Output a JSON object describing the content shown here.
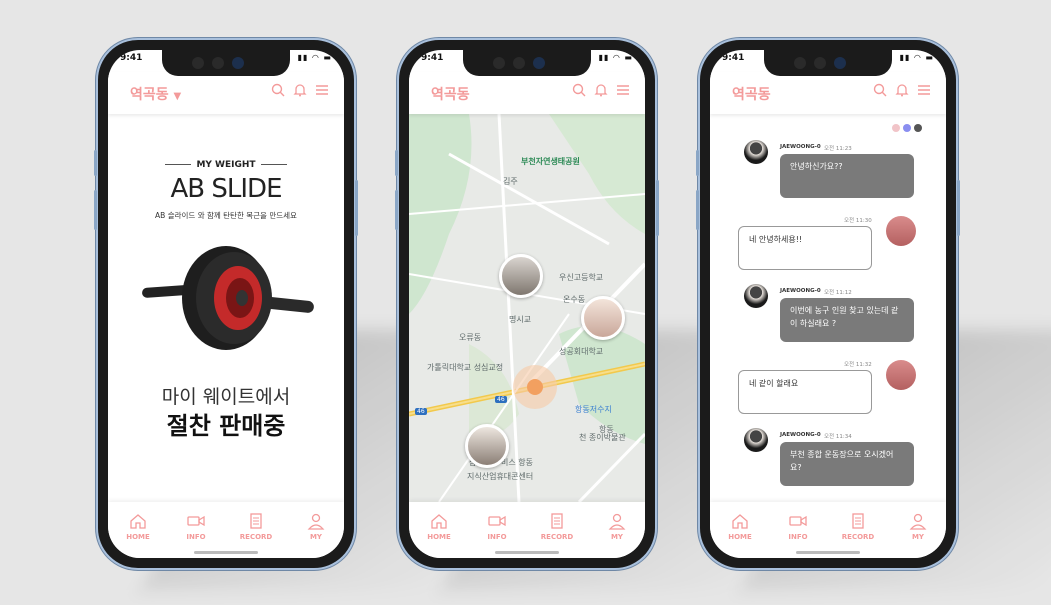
{
  "status": {
    "time": "9:41"
  },
  "phones": [
    {
      "location": "역곡동",
      "has_dropdown": true
    },
    {
      "location": "역곡동",
      "has_dropdown": false
    },
    {
      "location": "역곡동",
      "has_dropdown": false
    }
  ],
  "tabs": [
    {
      "label": "HOME",
      "icon": "home-icon"
    },
    {
      "label": "INFO",
      "icon": "video-icon"
    },
    {
      "label": "RECORD",
      "icon": "document-icon"
    },
    {
      "label": "MY",
      "icon": "user-icon"
    }
  ],
  "header_icons": [
    "search-icon",
    "bell-icon",
    "menu-icon"
  ],
  "product": {
    "brand": "MY WEIGHT",
    "title": "AB SLIDE",
    "subtitle": "AB 슬라이드 와 함께 탄탄한 복근을 만드세요",
    "promo_line1": "마이 웨이트에서",
    "promo_line2": "절찬 판매중"
  },
  "map": {
    "labels": [
      "부천자연생태공원",
      "우신고등학교",
      "가톨릭대학교 성심교정",
      "성공회대학교",
      "항동저수지",
      "온수동",
      "오류동",
      "지식산업휴대콘센터",
      "삼천",
      "비스 항동",
      "천 종이박물관",
      "항동",
      "김주",
      "명시교"
    ],
    "road_numbers": [
      "46",
      "46"
    ]
  },
  "chat": {
    "theme_dots": [
      "#f1c4c8",
      "#8a8ef0",
      "#555555"
    ],
    "messages": [
      {
        "side": "left",
        "name": "JAEWOONG-0",
        "time": "오전 11:23",
        "text": "안녕하신가요??"
      },
      {
        "side": "right",
        "time": "오전 11:30",
        "text": "네 안녕하세용!!"
      },
      {
        "side": "left",
        "name": "JAEWOONG-0",
        "time": "오전 11:12",
        "text": "이번에 농구 인원 찾고 있는데 같이 하실래요 ?"
      },
      {
        "side": "right",
        "time": "오전 11:32",
        "text": "네 같이 할래요"
      },
      {
        "side": "left",
        "name": "JAEWOONG-0",
        "time": "오전 11:34",
        "text": "부천 종합 운동장으로 오시겠어요?"
      }
    ]
  },
  "colors": {
    "accent": "#f39a9a",
    "bubble": "#7a7a7a",
    "frame": "#a9c0dc"
  }
}
